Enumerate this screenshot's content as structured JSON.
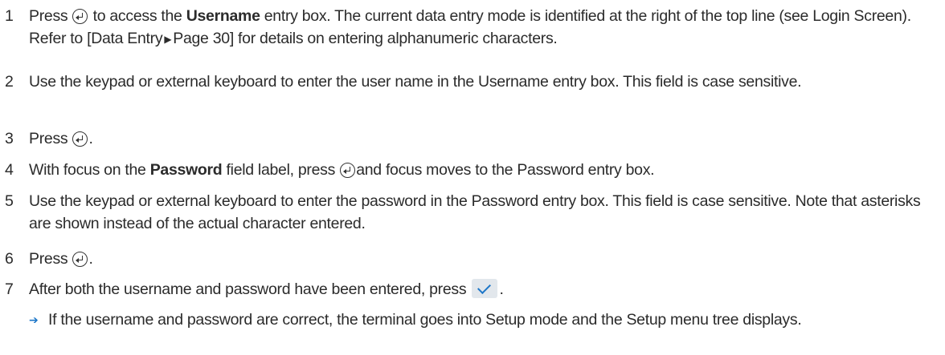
{
  "steps": [
    {
      "num": "1",
      "a": "Press",
      "b": "to access the",
      "bold": "Username",
      "c": "entry box. The current data entry mode is identified at the right of the top line (see Login Screen). Refer to [Data Entry",
      "d": "Page 30] for details on entering alphanumeric characters."
    },
    {
      "num": "2",
      "text": "Use the keypad or external keyboard to enter the user name in the Username entry box. This field is case sensitive."
    },
    {
      "num": "3",
      "a": "Press",
      "b": "."
    },
    {
      "num": "4",
      "a": "With focus on the",
      "bold": "Password",
      "b": "field label, press",
      "c": "and focus moves to the Password entry box."
    },
    {
      "num": "5",
      "text": "Use the keypad or external keyboard to enter the password in the Password entry box. This field is case sensitive. Note that asterisks are shown instead of the actual character entered."
    },
    {
      "num": "6",
      "a": "Press",
      "b": "."
    },
    {
      "num": "7",
      "a": "After both the username and password have been entered, press",
      "b": "."
    }
  ],
  "result": "If the username and password are correct, the terminal goes into Setup mode and the Setup menu tree displays.",
  "icons": {
    "enter": "enter-key-icon",
    "confirm": "checkmark-icon",
    "link": "triangle-right-icon",
    "result": "arrow-right-icon"
  },
  "colors": {
    "accent": "#1c76c8",
    "button_bg": "#e2e7ec",
    "text": "#2b2b2b"
  }
}
